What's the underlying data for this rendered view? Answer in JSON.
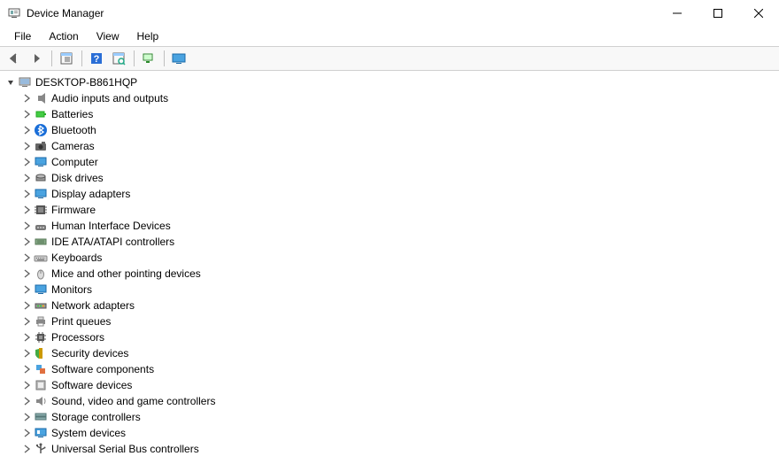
{
  "window": {
    "title": "Device Manager"
  },
  "menu": {
    "file": "File",
    "action": "Action",
    "view": "View",
    "help": "Help"
  },
  "tree": {
    "root": "DESKTOP-B861HQP",
    "categories": [
      {
        "icon": "audio",
        "label": "Audio inputs and outputs"
      },
      {
        "icon": "battery",
        "label": "Batteries"
      },
      {
        "icon": "bluetooth",
        "label": "Bluetooth"
      },
      {
        "icon": "camera",
        "label": "Cameras"
      },
      {
        "icon": "computer",
        "label": "Computer"
      },
      {
        "icon": "disk",
        "label": "Disk drives"
      },
      {
        "icon": "display",
        "label": "Display adapters"
      },
      {
        "icon": "firmware",
        "label": "Firmware"
      },
      {
        "icon": "hid",
        "label": "Human Interface Devices"
      },
      {
        "icon": "ide",
        "label": "IDE ATA/ATAPI controllers"
      },
      {
        "icon": "keyboard",
        "label": "Keyboards"
      },
      {
        "icon": "mouse",
        "label": "Mice and other pointing devices"
      },
      {
        "icon": "monitor",
        "label": "Monitors"
      },
      {
        "icon": "network",
        "label": "Network adapters"
      },
      {
        "icon": "printer",
        "label": "Print queues"
      },
      {
        "icon": "cpu",
        "label": "Processors"
      },
      {
        "icon": "security",
        "label": "Security devices"
      },
      {
        "icon": "swcomp",
        "label": "Software components"
      },
      {
        "icon": "swdev",
        "label": "Software devices"
      },
      {
        "icon": "sound",
        "label": "Sound, video and game controllers"
      },
      {
        "icon": "storage",
        "label": "Storage controllers"
      },
      {
        "icon": "system",
        "label": "System devices"
      },
      {
        "icon": "usb",
        "label": "Universal Serial Bus controllers"
      }
    ]
  }
}
